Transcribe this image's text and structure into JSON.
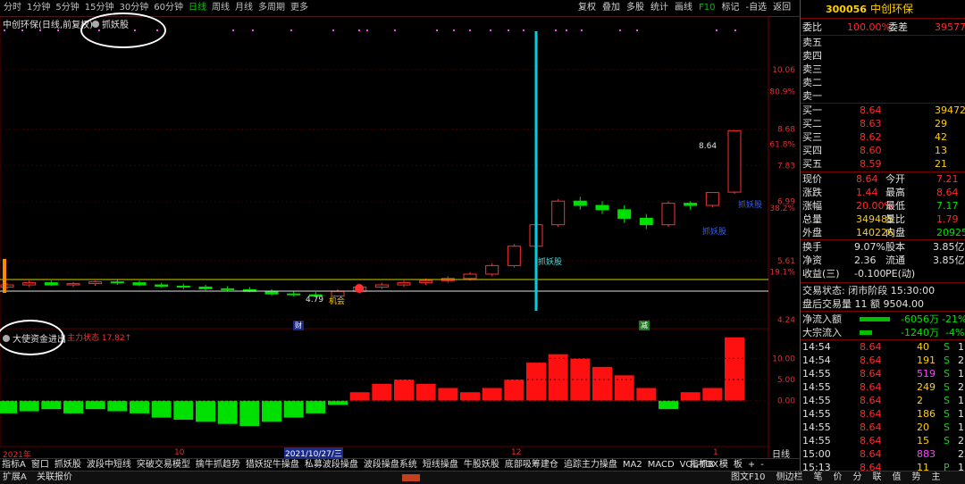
{
  "toolbar": {
    "periods": [
      "分时",
      "1分钟",
      "5分钟",
      "15分钟",
      "30分钟",
      "60分钟",
      "日线",
      "周线",
      "月线",
      "多周期",
      "更多"
    ],
    "active_period": "日线",
    "tools": [
      "复权",
      "叠加",
      "多股",
      "统计",
      "画线",
      "F10",
      "标记",
      "-自选",
      "返回"
    ]
  },
  "chart": {
    "title": "中创环保(日线,前复权)",
    "indicator_main": "抓妖股",
    "price_ticks": [
      "10.06",
      "8.68",
      "7.83",
      "6.99",
      "5.61",
      "4.24"
    ],
    "pct_ticks": [
      "80.9%",
      "61.8%",
      "38.2%",
      "19.1%"
    ],
    "annot_high": "8.64",
    "annot_low": "4.79",
    "annot_chance": "机会",
    "annot_zhuayao1": "抓妖股",
    "annot_zhuayao2": "抓妖股",
    "annot_zhuayao3": "抓妖股",
    "badge_cai": "财",
    "badge_jian": "减",
    "sub_title": "大使资金进出",
    "sub_status": "主力状态 17.82↑",
    "sub_ticks": [
      "10.00",
      "5.00",
      "0.00"
    ],
    "x_labels": [
      "2021年",
      "10",
      "2021/10/27/三",
      "12",
      "1"
    ],
    "period_label": "日线"
  },
  "chart_data": {
    "type": "candlestick",
    "ohlc": [
      [
        5.0,
        5.1,
        4.95,
        5.05
      ],
      [
        5.05,
        5.15,
        5.0,
        5.1
      ],
      [
        5.1,
        5.15,
        5.02,
        5.05
      ],
      [
        5.05,
        5.12,
        5.0,
        5.08
      ],
      [
        5.08,
        5.15,
        5.03,
        5.12
      ],
      [
        5.12,
        5.18,
        5.05,
        5.1
      ],
      [
        5.1,
        5.15,
        5.02,
        5.05
      ],
      [
        5.05,
        5.1,
        4.98,
        5.02
      ],
      [
        5.02,
        5.08,
        4.95,
        5.0
      ],
      [
        5.0,
        5.05,
        4.92,
        4.96
      ],
      [
        4.96,
        5.02,
        4.9,
        4.94
      ],
      [
        4.94,
        5.0,
        4.88,
        4.9
      ],
      [
        4.9,
        4.95,
        4.8,
        4.84
      ],
      [
        4.84,
        4.9,
        4.78,
        4.82
      ],
      [
        4.82,
        4.88,
        4.75,
        4.79
      ],
      [
        4.79,
        4.95,
        4.77,
        4.9
      ],
      [
        4.9,
        5.05,
        4.85,
        5.0
      ],
      [
        5.0,
        5.1,
        4.95,
        5.05
      ],
      [
        5.05,
        5.15,
        5.0,
        5.1
      ],
      [
        5.1,
        5.2,
        5.05,
        5.15
      ],
      [
        5.15,
        5.25,
        5.1,
        5.2
      ],
      [
        5.2,
        5.35,
        5.15,
        5.3
      ],
      [
        5.3,
        5.55,
        5.25,
        5.5
      ],
      [
        5.5,
        6.0,
        5.45,
        5.95
      ],
      [
        5.95,
        6.5,
        5.9,
        6.45
      ],
      [
        6.45,
        7.05,
        6.4,
        7.0
      ],
      [
        7.0,
        7.1,
        6.8,
        6.9
      ],
      [
        6.9,
        7.0,
        6.7,
        6.8
      ],
      [
        6.8,
        6.9,
        6.5,
        6.6
      ],
      [
        6.6,
        6.7,
        6.35,
        6.45
      ],
      [
        6.45,
        7.0,
        6.4,
        6.95
      ],
      [
        6.95,
        7.0,
        6.8,
        6.9
      ],
      [
        6.9,
        7.21,
        6.85,
        7.2
      ],
      [
        7.21,
        8.64,
        7.17,
        8.64
      ]
    ],
    "flow": [
      -3,
      -2.5,
      -2,
      -3,
      -2,
      -2.5,
      -3,
      -4,
      -4.5,
      -5,
      -5.5,
      -6,
      -5,
      -4,
      -3,
      -1,
      2,
      4,
      5,
      4,
      3,
      2,
      3,
      5,
      9,
      11,
      10,
      8,
      6,
      3,
      -2,
      2,
      3,
      15
    ],
    "ylim": [
      4.24,
      10.06
    ],
    "flow_ylim": [
      -10,
      16
    ]
  },
  "panel": {
    "code": "300056",
    "name": "中创环保",
    "weibi_label": "委比",
    "weibi": "100.00%",
    "weicha_label": "委差",
    "weicha": "39577",
    "asks": [
      {
        "label": "卖五",
        "price": "",
        "vol": ""
      },
      {
        "label": "卖四",
        "price": "",
        "vol": ""
      },
      {
        "label": "卖三",
        "price": "",
        "vol": ""
      },
      {
        "label": "卖二",
        "price": "",
        "vol": ""
      },
      {
        "label": "卖一",
        "price": "",
        "vol": ""
      }
    ],
    "bids": [
      {
        "label": "买一",
        "price": "8.64",
        "vol": "39472"
      },
      {
        "label": "买二",
        "price": "8.63",
        "vol": "29"
      },
      {
        "label": "买三",
        "price": "8.62",
        "vol": "42"
      },
      {
        "label": "买四",
        "price": "8.60",
        "vol": "13"
      },
      {
        "label": "买五",
        "price": "8.59",
        "vol": "21"
      }
    ],
    "quote": [
      {
        "l1": "现价",
        "v1": "8.64",
        "l2": "今开",
        "v2": "7.21"
      },
      {
        "l1": "涨跌",
        "v1": "1.44",
        "l2": "最高",
        "v2": "8.64"
      },
      {
        "l1": "涨幅",
        "v1": "20.00%",
        "l2": "最低",
        "v2": "7.17"
      },
      {
        "l1": "总量",
        "v1": "349485",
        "l2": "量比",
        "v2": "1.79"
      },
      {
        "l1": "外盘",
        "v1": "140226",
        "l2": "内盘",
        "v2": "209259"
      }
    ],
    "stats": [
      {
        "l1": "换手",
        "v1": "9.07%",
        "l2": "股本",
        "v2": "3.85亿"
      },
      {
        "l1": "净资",
        "v1": "2.36",
        "l2": "流通",
        "v2": "3.85亿"
      },
      {
        "l1": "收益(三)",
        "v1": "-0.100",
        "l2": "PE(动)",
        "v2": ""
      }
    ],
    "trade_status": "交易状态: 闭市阶段 15:30:00",
    "after_trade": "盘后交易量 11 额 9504.00",
    "net_inflow_label": "净流入额",
    "net_inflow": "-6056万",
    "net_inflow_pct": "-21%",
    "block_inflow_label": "大宗流入",
    "block_inflow": "-1240万",
    "block_inflow_pct": "-4%",
    "ticks": [
      {
        "time": "14:54",
        "price": "8.64",
        "vol": "40",
        "side": "S",
        "n": "1"
      },
      {
        "time": "14:54",
        "price": "8.64",
        "vol": "191",
        "side": "S",
        "n": "2"
      },
      {
        "time": "14:55",
        "price": "8.64",
        "vol": "519",
        "side": "S",
        "n": "1"
      },
      {
        "time": "14:55",
        "price": "8.64",
        "vol": "249",
        "side": "S",
        "n": "2"
      },
      {
        "time": "14:55",
        "price": "8.64",
        "vol": "2",
        "side": "S",
        "n": "1"
      },
      {
        "time": "14:55",
        "price": "8.64",
        "vol": "186",
        "side": "S",
        "n": "1"
      },
      {
        "time": "14:55",
        "price": "8.64",
        "vol": "20",
        "side": "S",
        "n": "1"
      },
      {
        "time": "14:55",
        "price": "8.64",
        "vol": "15",
        "side": "S",
        "n": "2"
      },
      {
        "time": "15:00",
        "price": "8.64",
        "vol": "883",
        "side": "",
        "n": "22"
      },
      {
        "time": "15:13",
        "price": "8.64",
        "vol": "11",
        "side": "P",
        "n": "1"
      }
    ]
  },
  "bottom_tabs": [
    "指标A",
    "窗口",
    "抓妖股",
    "波段中短线",
    "突破交易模型",
    "擒牛抓趋势",
    "猎妖捉牛操盘",
    "私募波段操盘",
    "波段操盘系统",
    "短线操盘",
    "牛股妖股",
    "底部吸筹建仓",
    "追踪主力操盘",
    "MA2",
    "MACD",
    "VOL-TDX"
  ],
  "bottom_right": [
    "指标B",
    "模",
    "板",
    "+",
    "-"
  ],
  "status_bar": {
    "left1": "扩展A",
    "left2": "关联报价",
    "right": [
      "图文F10",
      "侧边栏",
      "笔",
      "价",
      "分",
      "联",
      "值",
      "势",
      "主"
    ]
  }
}
